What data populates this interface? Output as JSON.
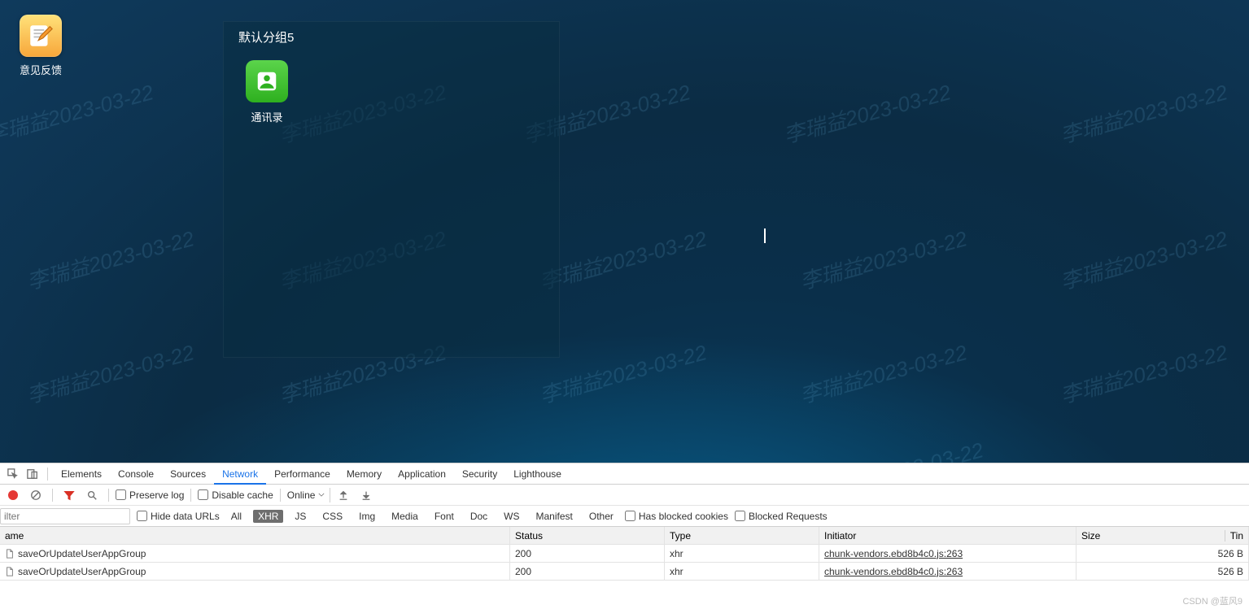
{
  "watermark_text": "李瑞益2023-03-22",
  "desktop": {
    "feedback_icon_label": "意见反馈",
    "group_panel": {
      "title": "默认分组5",
      "contacts_label": "通讯录"
    }
  },
  "devtools": {
    "tabs": {
      "elements": "Elements",
      "console": "Console",
      "sources": "Sources",
      "network": "Network",
      "performance": "Performance",
      "memory": "Memory",
      "application": "Application",
      "security": "Security",
      "lighthouse": "Lighthouse"
    },
    "toolbar": {
      "preserve_log": "Preserve log",
      "disable_cache": "Disable cache",
      "throttling": "Online"
    },
    "filterbar": {
      "filter_placeholder": "ilter",
      "hide_data_urls": "Hide data URLs",
      "pills": {
        "all": "All",
        "xhr": "XHR",
        "js": "JS",
        "css": "CSS",
        "img": "Img",
        "media": "Media",
        "font": "Font",
        "doc": "Doc",
        "ws": "WS",
        "manifest": "Manifest",
        "other": "Other"
      },
      "has_blocked_cookies": "Has blocked cookies",
      "blocked_requests": "Blocked Requests"
    },
    "grid": {
      "headers": {
        "name": "ame",
        "status": "Status",
        "type": "Type",
        "initiator": "Initiator",
        "size": "Size",
        "time": "Tin"
      },
      "rows": [
        {
          "name": "saveOrUpdateUserAppGroup",
          "status": "200",
          "type": "xhr",
          "initiator": "chunk-vendors.ebd8b4c0.js:263",
          "size": "526 B"
        },
        {
          "name": "saveOrUpdateUserAppGroup",
          "status": "200",
          "type": "xhr",
          "initiator": "chunk-vendors.ebd8b4c0.js:263",
          "size": "526 B"
        }
      ]
    }
  },
  "footer": "CSDN @蓝风9"
}
